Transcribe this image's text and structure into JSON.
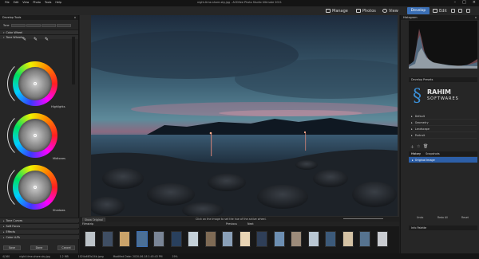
{
  "titlebar": {
    "menu": [
      "File",
      "Edit",
      "View",
      "Photo",
      "Tools",
      "Help"
    ],
    "title": "night-time-shore-sky.jpg - ACDSee Photo Studio Ultimate 2021",
    "controls": [
      "minimize-icon",
      "maximize-icon",
      "close-icon"
    ]
  },
  "toolbar": {
    "modes": [
      {
        "label": "Manage",
        "icon": "grid-icon"
      },
      {
        "label": "Photos",
        "icon": "photos-icon"
      },
      {
        "label": "View",
        "icon": "eye-icon"
      },
      {
        "label": "Develop",
        "icon": "develop-icon"
      },
      {
        "label": "Edit",
        "icon": "edit-icon"
      }
    ]
  },
  "left_panel": {
    "title": "Develop Tools",
    "tone_label": "Tone",
    "color_wheel_label": "Color Wheel",
    "tone_wheels_label": "Tone Wheels",
    "wheel_labels": [
      "Highlights",
      "Midtones",
      "Shadows"
    ],
    "sections": [
      "Tone Curves",
      "Soft Focus",
      "Effects",
      "Color LUTs"
    ],
    "buttons": {
      "save": "Save",
      "done": "Done",
      "cancel": "Cancel"
    }
  },
  "canvas": {
    "before_original": "Show Original",
    "hint": "Click on the image to set the hue of the active wheel."
  },
  "filmstrip": {
    "label": "Filmstrip",
    "prev": "Previous",
    "next": "Next",
    "thumb_colors": [
      "#bcc3c8",
      "#3f4e63",
      "#caa36a",
      "#4b6f95",
      "#7a8596",
      "#29405d",
      "#c4d0d8",
      "#7f6b55",
      "#8aa0b8",
      "#e8d4b4",
      "#2f3f58",
      "#6d8fb2",
      "#9c8b7a",
      "#b9c7d3",
      "#3c5a7a",
      "#d4c2a4",
      "#56738f",
      "#c9ccd1"
    ]
  },
  "right_panel": {
    "histogram_label": "Histogram",
    "develop_presets_label": "Develop Presets",
    "logo_title": "RAHIM",
    "logo_subtitle": "SOFTWARES",
    "presets": [
      "Default",
      "Geometry",
      "Landscape",
      "Portrait"
    ],
    "history_tabs": [
      "History",
      "Snapshots"
    ],
    "history_item": "Original Image",
    "bottom_buttons": [
      "Undo",
      "Redo All",
      "Reset"
    ],
    "info_label": "Info Palette"
  },
  "statusbar": {
    "items": [
      "4/160",
      "night-time-shore-sky.jpg",
      "1.2 MB",
      "1024x683x24b jpeg",
      "Modified Date: 2020-06-18 1:45:43 PM",
      "19%"
    ]
  },
  "colors": {
    "accent": "#3b6fb5",
    "panel": "#262626"
  }
}
